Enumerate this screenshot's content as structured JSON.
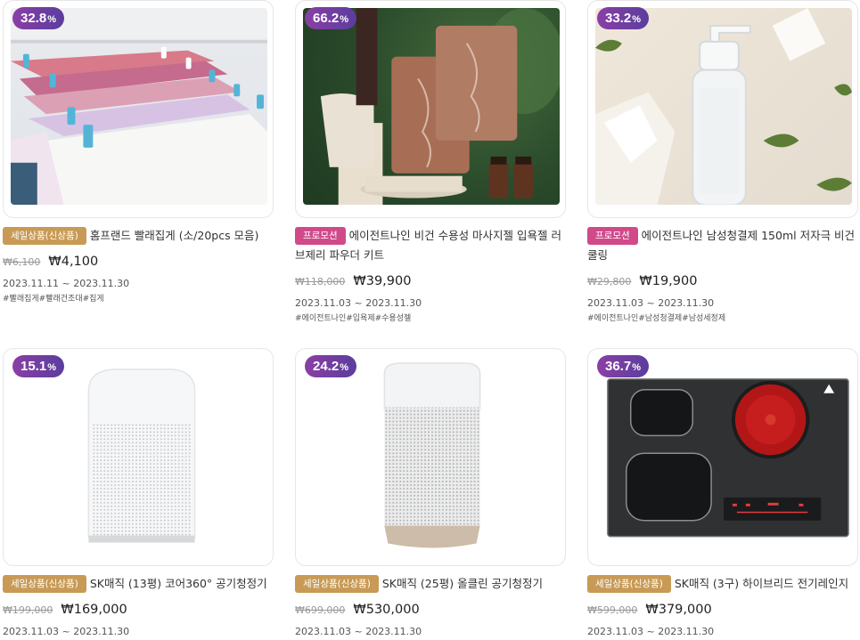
{
  "products": [
    {
      "discount": "32.8",
      "discount_unit": "%",
      "tag": "세일상품(신상품)",
      "title": "홈프랜드 빨래집게 (소/20pcs 모음)",
      "original_price": "₩6,100",
      "price": "₩4,100",
      "period": "2023.11.11 ~ 2023.11.30",
      "hashtags": "#빨래집게#빨래건조대#집게"
    },
    {
      "discount": "66.2",
      "discount_unit": "%",
      "tag": "프로모션",
      "title": "에이전트나인 비건 수용성 마사지젤 입욕젤 러브제리 파우더 키트",
      "original_price": "₩118,000",
      "price": "₩39,900",
      "period": "2023.11.03 ~ 2023.11.30",
      "hashtags": "#에이전트나인#입욕제#수용성젤"
    },
    {
      "discount": "33.2",
      "discount_unit": "%",
      "tag": "프로모션",
      "title": "에이전트나인 남성청결제 150ml 저자극 비건 쿨링",
      "original_price": "₩29,800",
      "price": "₩19,900",
      "period": "2023.11.03 ~ 2023.11.30",
      "hashtags": "#에이전트나인#남성청결제#남성세정제"
    },
    {
      "discount": "15.1",
      "discount_unit": "%",
      "tag": "세일상품(신상품)",
      "title": "SK매직 (13평) 코어360° 공기청정기",
      "original_price": "₩199,000",
      "price": "₩169,000",
      "period": "2023.11.03 ~ 2023.11.30",
      "hashtags": ""
    },
    {
      "discount": "24.2",
      "discount_unit": "%",
      "tag": "세일상품(신상품)",
      "title": "SK매직 (25평) 올클린 공기청정기",
      "original_price": "₩699,000",
      "price": "₩530,000",
      "period": "2023.11.03 ~ 2023.11.30",
      "hashtags": ""
    },
    {
      "discount": "36.7",
      "discount_unit": "%",
      "tag": "세일상품(신상품)",
      "title": "SK매직 (3구) 하이브리드 전기레인지",
      "original_price": "₩599,000",
      "price": "₩379,000",
      "period": "2023.11.03 ~ 2023.11.30",
      "hashtags": ""
    }
  ]
}
